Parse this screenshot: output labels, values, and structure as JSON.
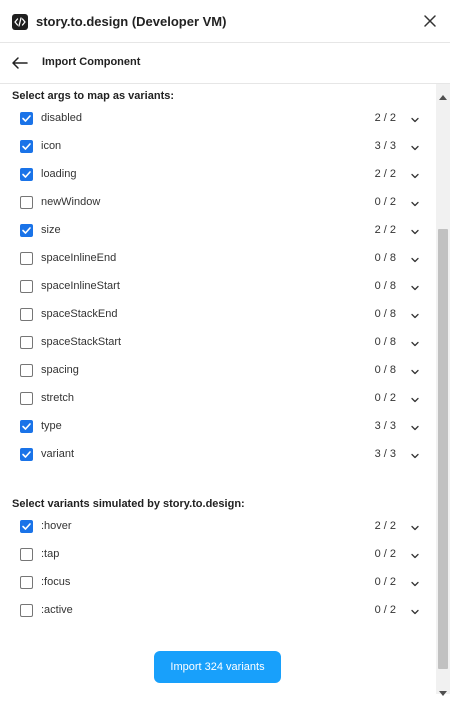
{
  "window": {
    "title": "story.to.design (Developer VM)"
  },
  "header": {
    "title": "Import Component"
  },
  "args_section": {
    "title": "Select args to map as variants:"
  },
  "args": [
    {
      "label": "disabled",
      "checked": true,
      "count": "2 / 2"
    },
    {
      "label": "icon",
      "checked": true,
      "count": "3 / 3"
    },
    {
      "label": "loading",
      "checked": true,
      "count": "2 / 2"
    },
    {
      "label": "newWindow",
      "checked": false,
      "count": "0 / 2"
    },
    {
      "label": "size",
      "checked": true,
      "count": "2 / 2"
    },
    {
      "label": "spaceInlineEnd",
      "checked": false,
      "count": "0 / 8"
    },
    {
      "label": "spaceInlineStart",
      "checked": false,
      "count": "0 / 8"
    },
    {
      "label": "spaceStackEnd",
      "checked": false,
      "count": "0 / 8"
    },
    {
      "label": "spaceStackStart",
      "checked": false,
      "count": "0 / 8"
    },
    {
      "label": "spacing",
      "checked": false,
      "count": "0 / 8"
    },
    {
      "label": "stretch",
      "checked": false,
      "count": "0 / 2"
    },
    {
      "label": "type",
      "checked": true,
      "count": "3 / 3"
    },
    {
      "label": "variant",
      "checked": true,
      "count": "3 / 3"
    }
  ],
  "sim_section": {
    "title": "Select variants simulated by story.to.design:"
  },
  "simulated": [
    {
      "label": ":hover",
      "checked": true,
      "count": "2 / 2"
    },
    {
      "label": ":tap",
      "checked": false,
      "count": "0 / 2"
    },
    {
      "label": ":focus",
      "checked": false,
      "count": "0 / 2"
    },
    {
      "label": ":active",
      "checked": false,
      "count": "0 / 2"
    }
  ],
  "import_button": {
    "label": "Import 324 variants"
  },
  "colors": {
    "accent": "#18a0fb",
    "checkbox_checked": "#1a73e8"
  },
  "icons": {
    "logo": "code-icon",
    "close": "close-icon",
    "back": "arrow-left-icon",
    "expand": "chevron-down-icon"
  }
}
